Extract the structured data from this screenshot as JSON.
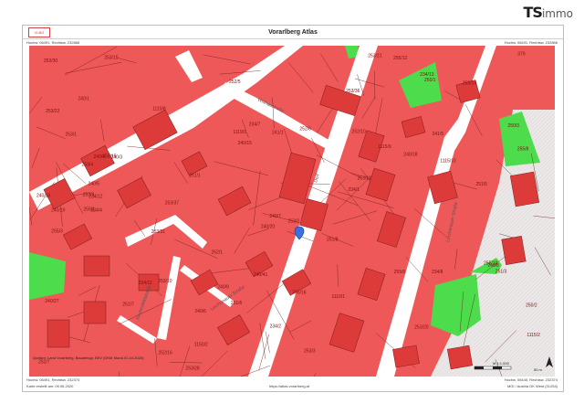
{
  "brand": {
    "ts": "TS",
    "immo": "immo"
  },
  "sheet": {
    "title": "Vorarlberg Atlas",
    "top_left_coord": "Hochw. 06491, Rechtsw. 232866",
    "top_right_coord": "Hochw. 06491, Rechtsw. 232866",
    "bottom_left_coord": "Hochw. 06491, Rechtsw. 232374",
    "bottom_right_coord": "Hochw. 06440, Rechtsw. 232374",
    "left_side_coord": "Hochw. 06491",
    "right_side_coord": "Hochw. 06440",
    "source_text": "Quellen: Land Vorarlberg, Bauamtsgr. BEV (DKM Stand 01.04.2020)",
    "created": "Karte erstellt am: 09.06.2020",
    "url": "https://atlas.vorarlberg.at",
    "crs": "MGI / Austria GK West (31254)",
    "scale": "M 1:1.000",
    "scale_len": "50 m"
  },
  "map": {
    "parcel_labels": [
      "253/1",
      "253/2",
      "253/3",
      "253/4",
      "240/1",
      "240/3",
      "240/4",
      "240/5",
      "240/6",
      "240/7",
      "240/8",
      "240/9",
      "241/1",
      "241/5",
      "234/1",
      "234/2",
      "234/4",
      "234/7",
      "234/8",
      "234/11",
      "234/12",
      "234/13",
      "240/15",
      "240/16",
      "240/18",
      "240/19",
      "240/20",
      "240/27",
      "240/41",
      "250/1",
      "250/2",
      "250/3",
      "251/1",
      "251/3",
      "251/5",
      "251/6",
      "251/7",
      "251/8",
      "252/1",
      "252/4",
      "252/5",
      "252/6",
      "252/7",
      "252/10",
      "252/16",
      "253/10",
      "253/11",
      "253/14",
      "253/15",
      "253/20",
      "253/21",
      "253/22",
      "253/28",
      "253/30",
      "253/31",
      "253/36",
      "253/37",
      "255/1",
      "255/3",
      "255/6",
      "255/8",
      "255/10",
      "255/12",
      "255/15",
      "255/16",
      "1110/1",
      "1115/2",
      "1115/8",
      "1115/9",
      "1115/10",
      "1119/1",
      "1150/2",
      "379"
    ],
    "streets": [
      "Lerchenauer Straße",
      "Lerchenauer Straße",
      "Widnaustraße",
      "Dorf",
      "Kirchenfeldstraße"
    ],
    "marker": "location-pin"
  }
}
